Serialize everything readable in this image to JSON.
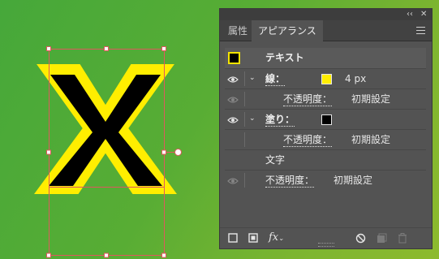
{
  "canvas": {
    "letter": "X",
    "stroke_color": "#ffee00",
    "fill_color": "#000000",
    "selection_color": "#e0585e"
  },
  "panel": {
    "titlebar": {
      "collapse_glyph": "‹‹",
      "close_glyph": "✕"
    },
    "tabs": [
      {
        "label": "属性"
      },
      {
        "label": "アピアランス"
      }
    ],
    "menu_icon": "hamburger-menu-icon",
    "object_label": "テキスト",
    "stroke": {
      "label": "線：",
      "color": "#ffee00",
      "weight": "4 px",
      "opacity_label": "不透明度：",
      "opacity_value": "初期設定"
    },
    "fill": {
      "label": "塗り：",
      "color": "#000000",
      "opacity_label": "不透明度：",
      "opacity_value": "初期設定"
    },
    "characters_label": "文字",
    "opacity": {
      "label": "不透明度：",
      "value": "初期設定"
    },
    "footer_fx": "fx"
  }
}
